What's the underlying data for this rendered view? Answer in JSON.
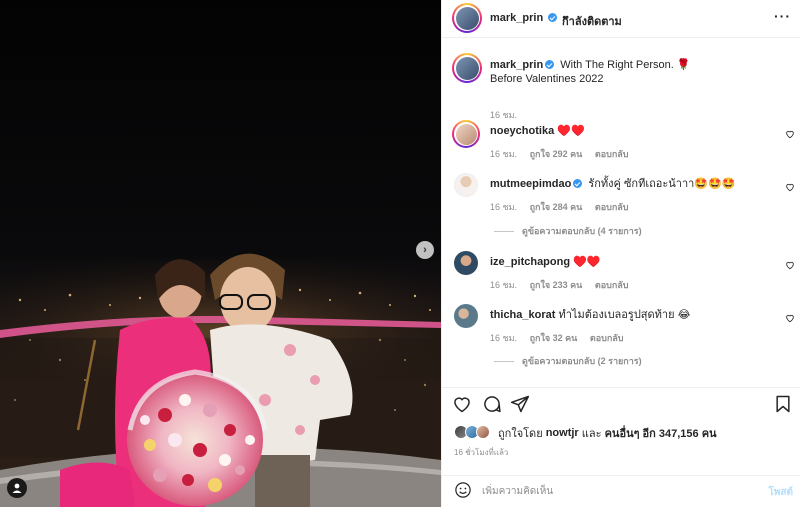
{
  "photo": {
    "next_label": "›"
  },
  "header": {
    "username": "mark_prin",
    "separator": "•",
    "follow_label": "กำลังติดตาม",
    "more_label": "···"
  },
  "caption": {
    "username": "mark_prin",
    "line1": "With The Right Person. 🌹",
    "line2": "Before Valentines 2022",
    "time": "16 ชม."
  },
  "comments": [
    {
      "username": "noeychotika",
      "text": "♥️♥️",
      "time": "16 ชม.",
      "likes": "ถูกใจ 292 คน",
      "reply": "ตอบกลับ",
      "verified": false
    },
    {
      "username": "mutmeepimdao",
      "text": "รักทั้งคู่ ซักทีเถอะน้าาา🤩🤩🤩",
      "time": "16 ชม.",
      "likes": "ถูกใจ 284 คน",
      "reply": "ตอบกลับ",
      "verified": true,
      "replies": "ดูข้อความตอบกลับ (4 รายการ)"
    },
    {
      "username": "ize_pitchapong",
      "text": "♥️♥️",
      "time": "16 ชม.",
      "likes": "ถูกใจ 233 คน",
      "reply": "ตอบกลับ",
      "verified": false
    },
    {
      "username": "thicha_korat",
      "text": "ทำไมต้องเบลอรูปสุดท้าย 😂",
      "time": "16 ชม.",
      "likes": "ถูกใจ 32 คน",
      "reply": "ตอบกลับ",
      "verified": false,
      "replies": "ดูข้อความตอบกลับ (2 รายการ)"
    }
  ],
  "likes": {
    "prefix": "ถูกใจโดย",
    "user": "nowtjr",
    "and": "และ",
    "others": "คนอื่นๆ อีก 347,156 คน"
  },
  "timestamp": "16 ชั่วโมงที่แล้ว",
  "composer": {
    "placeholder": "เพิ่มความคิดเห็น",
    "post_label": "โพสต์"
  },
  "colors": {
    "verified": "#3897f0",
    "heart_red": "#ed4956",
    "post_disabled": "#b2dffc",
    "secondary_text": "#8e8e8e"
  }
}
